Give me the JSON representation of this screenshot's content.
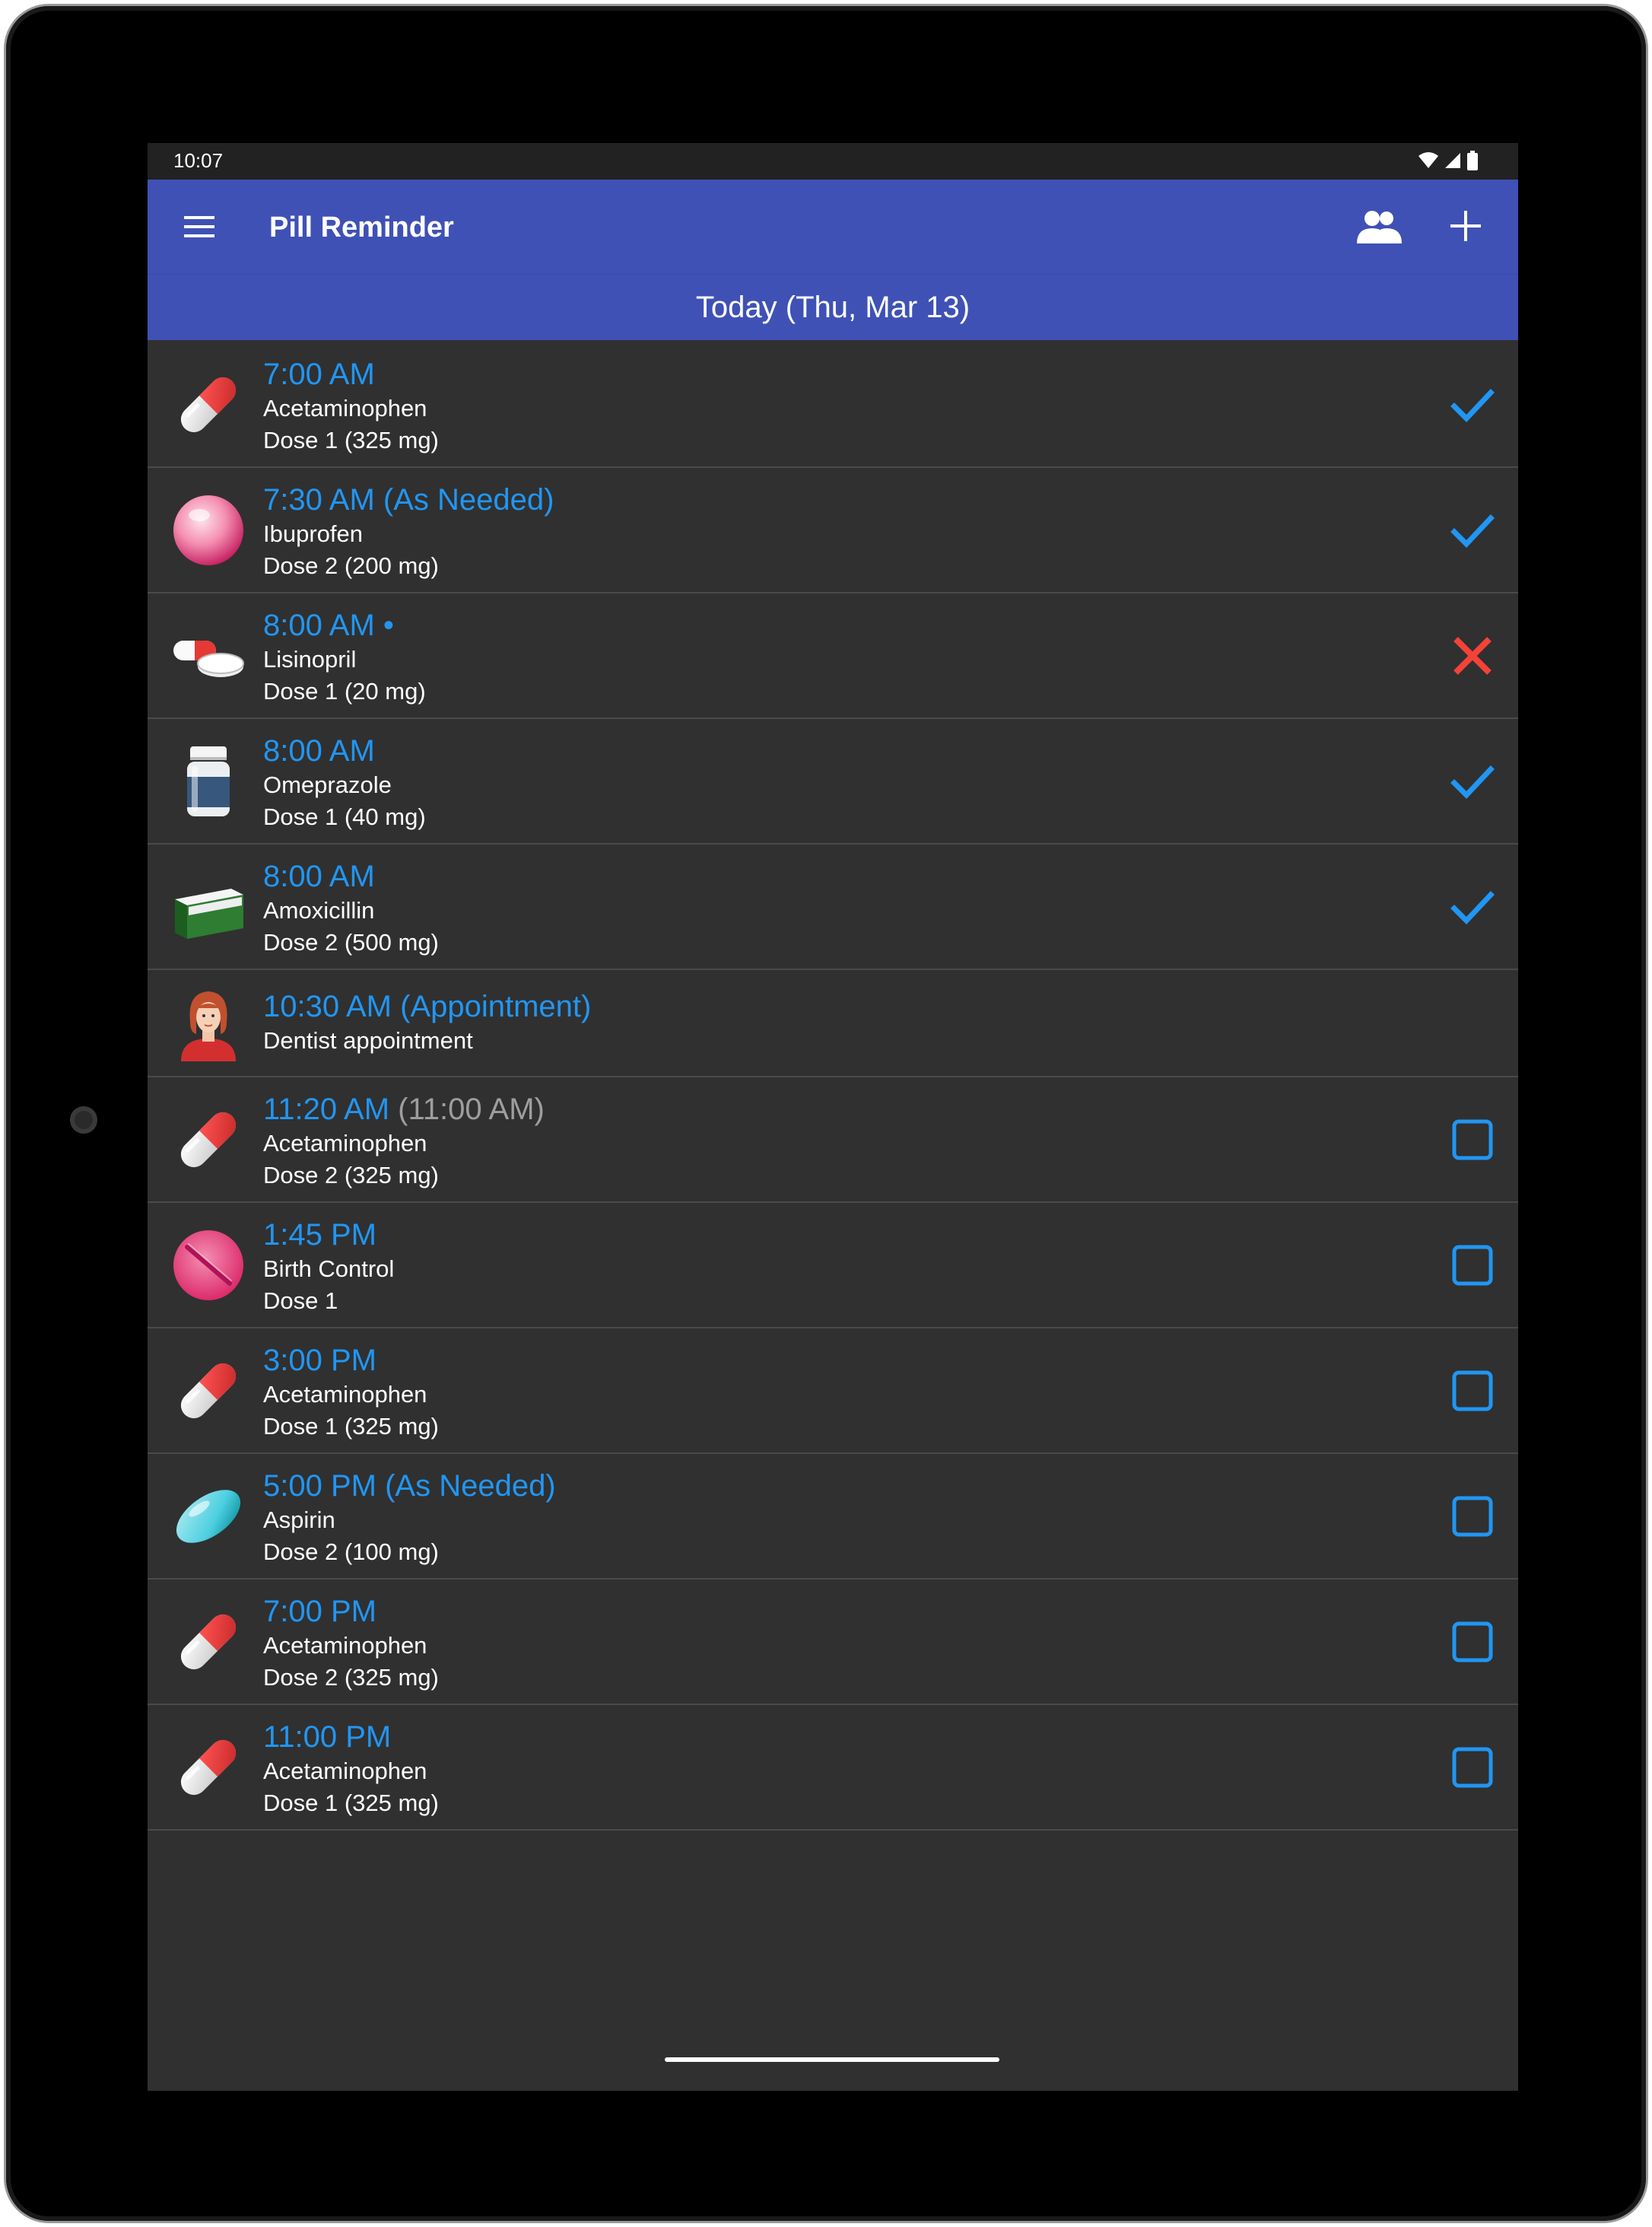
{
  "statusbar": {
    "time": "10:07"
  },
  "appbar": {
    "title": "Pill Reminder"
  },
  "date_header": "Today (Thu, Mar 13)",
  "colors": {
    "primary": "#3f51b5",
    "accent": "#2196f3",
    "error": "#f44336",
    "background": "#303030"
  },
  "items": [
    {
      "time": "7:00 AM",
      "orig_time": "",
      "name": "Acetaminophen",
      "dose": "Dose 1 (325 mg)",
      "icon": "capsule-red-white-icon",
      "status": "taken"
    },
    {
      "time": "7:30 AM (As Needed)",
      "orig_time": "",
      "name": "Ibuprofen",
      "dose": "Dose 2 (200 mg)",
      "icon": "pink-round-pill-icon",
      "status": "taken"
    },
    {
      "time": "8:00 AM •",
      "orig_time": "",
      "name": "Lisinopril",
      "dose": "Dose 1 (20 mg)",
      "icon": "pills-icon",
      "status": "skipped"
    },
    {
      "time": "8:00 AM",
      "orig_time": "",
      "name": "Omeprazole",
      "dose": "Dose 1 (40 mg)",
      "icon": "pill-bottle-icon",
      "status": "taken"
    },
    {
      "time": "8:00 AM",
      "orig_time": "",
      "name": "Amoxicillin",
      "dose": "Dose 2 (500 mg)",
      "icon": "medicine-box-icon",
      "status": "taken"
    },
    {
      "time": "10:30 AM (Appointment)",
      "orig_time": "",
      "name": "Dentist appointment",
      "dose": "",
      "icon": "doctor-avatar-icon",
      "status": "none"
    },
    {
      "time": "11:20 AM",
      "orig_time": "(11:00 AM)",
      "name": "Acetaminophen",
      "dose": "Dose 2 (325 mg)",
      "icon": "capsule-red-white-icon",
      "status": "pending"
    },
    {
      "time": "1:45 PM",
      "orig_time": "",
      "name": "Birth Control",
      "dose": "Dose 1",
      "icon": "pink-tablet-icon",
      "status": "pending"
    },
    {
      "time": "3:00 PM",
      "orig_time": "",
      "name": "Acetaminophen",
      "dose": "Dose 1 (325 mg)",
      "icon": "capsule-red-white-icon",
      "status": "pending"
    },
    {
      "time": "5:00 PM (As Needed)",
      "orig_time": "",
      "name": "Aspirin",
      "dose": "Dose 2 (100 mg)",
      "icon": "teal-softgel-icon",
      "status": "pending"
    },
    {
      "time": "7:00 PM",
      "orig_time": "",
      "name": "Acetaminophen",
      "dose": "Dose 2 (325 mg)",
      "icon": "capsule-red-white-icon",
      "status": "pending"
    },
    {
      "time": "11:00 PM",
      "orig_time": "",
      "name": "Acetaminophen",
      "dose": "Dose 1 (325 mg)",
      "icon": "capsule-red-white-icon",
      "status": "pending"
    }
  ]
}
